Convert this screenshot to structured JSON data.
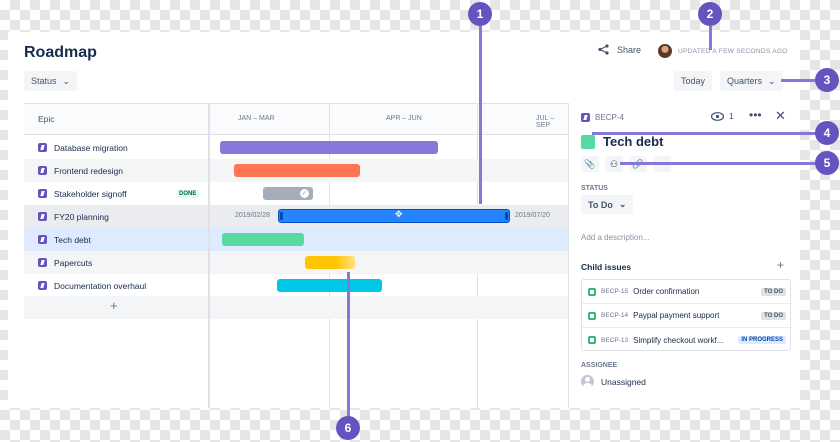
{
  "header": {
    "title": "Roadmap",
    "share_label": "Share",
    "updated_label": "UPDATED A FEW SECONDS AGO",
    "status_filter": "Status",
    "today_label": "Today",
    "zoom_label": "Quarters"
  },
  "table": {
    "epic_header": "Epic",
    "months": [
      "JAN – MAR",
      "APR – JUN",
      "JUL – SEP"
    ],
    "rows": [
      {
        "label": "Database migration",
        "color": "#8777D9"
      },
      {
        "label": "Frontend redesign",
        "color": "#FF7452"
      },
      {
        "label": "Stakeholder signoff",
        "color": "#A5ADBA",
        "badge": "DONE"
      },
      {
        "label": "FY20 planning",
        "color": "#2684FF",
        "start": "2019/02/28",
        "end": "2019/07/20"
      },
      {
        "label": "Tech debt",
        "color": "#57D9A3"
      },
      {
        "label": "Papercuts",
        "color": "#FFC400"
      },
      {
        "label": "Documentation overhaul",
        "color": "#00C7E6"
      }
    ],
    "add_label": "+"
  },
  "panel": {
    "issue_key": "BECP-4",
    "watchers": "1",
    "title": "Tech debt",
    "status_label": "STATUS",
    "status_value": "To Do",
    "description_placeholder": "Add a description...",
    "child_title": "Child issues",
    "children": [
      {
        "key": "BECP-15",
        "summary": "Order confirmation",
        "status": "TO DO"
      },
      {
        "key": "BECP-14",
        "summary": "Paypal payment support",
        "status": "TO DO"
      },
      {
        "key": "BECP-13",
        "summary": "Simplify checkout workf...",
        "status": "IN PROGRESS"
      }
    ],
    "assignee_label": "ASSIGNEE",
    "assignee_value": "Unassigned"
  },
  "callouts": [
    "1",
    "2",
    "3",
    "4",
    "5",
    "6"
  ],
  "colors": {
    "accent": "#0052CC",
    "callout": "#6554C0"
  }
}
